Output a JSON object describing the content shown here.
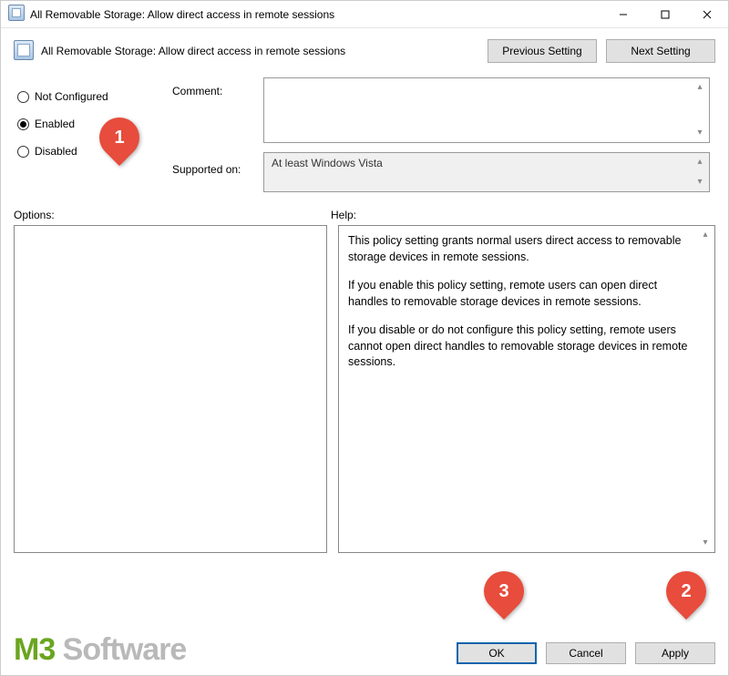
{
  "window": {
    "title": "All Removable Storage: Allow direct access in remote sessions"
  },
  "header": {
    "policy_name": "All Removable Storage: Allow direct access in remote sessions",
    "prev_btn": "Previous Setting",
    "next_btn": "Next Setting"
  },
  "radios": {
    "not_configured": "Not Configured",
    "enabled": "Enabled",
    "disabled": "Disabled",
    "selected": "enabled"
  },
  "labels": {
    "comment": "Comment:",
    "supported": "Supported on:",
    "options": "Options:",
    "help": "Help:"
  },
  "fields": {
    "comment_value": "",
    "supported_value": "At least Windows Vista"
  },
  "help": {
    "p1": "This policy setting grants normal users direct access to removable storage devices in remote sessions.",
    "p2": "If you enable this policy setting, remote users can open direct handles to removable storage devices in remote sessions.",
    "p3": "If you disable or do not configure this policy setting, remote users cannot open direct handles to removable storage devices in remote sessions."
  },
  "buttons": {
    "ok": "OK",
    "cancel": "Cancel",
    "apply": "Apply"
  },
  "watermark": {
    "m3": "M3",
    "rest": " Software"
  },
  "annotations": {
    "m1": "1",
    "m2": "2",
    "m3": "3"
  }
}
